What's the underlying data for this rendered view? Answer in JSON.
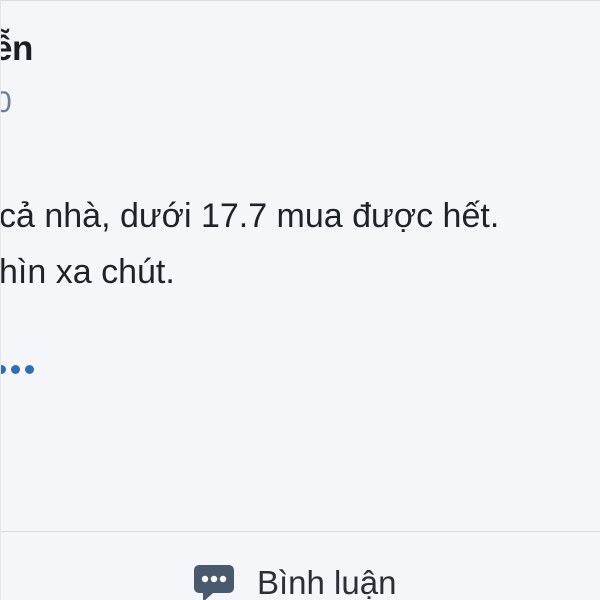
{
  "post": {
    "author_name": "ễn",
    "meta_text": "0",
    "body_lines": [
      "cả nhà, dưới 17.7 mua được hết.",
      "hìn xa chút."
    ]
  },
  "actions": {
    "comment_label": "Bình luận",
    "comment_icon": "comment-bubble-icon"
  },
  "colors": {
    "background": "#f4f6f9",
    "accent": "#2d6fb5",
    "icon": "#4a5a6e"
  }
}
